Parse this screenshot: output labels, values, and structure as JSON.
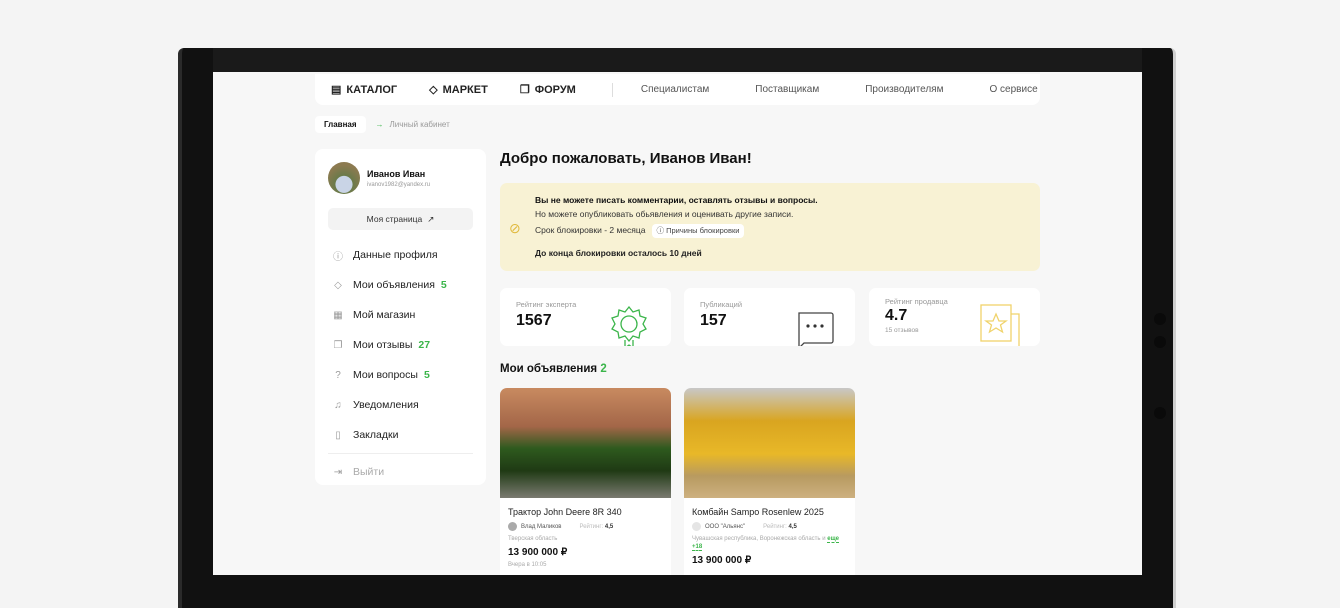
{
  "nav": {
    "main": [
      {
        "label": "КАТАЛОГ",
        "icon": "catalog-icon"
      },
      {
        "label": "МАРКЕТ",
        "icon": "market-icon"
      },
      {
        "label": "ФОРУМ",
        "icon": "forum-icon"
      }
    ],
    "secondary": [
      "Специалистам",
      "Поставщикам",
      "Производителям",
      "О сервисе"
    ]
  },
  "breadcrumb": {
    "home": "Главная",
    "current": "Личный кабинет"
  },
  "user": {
    "name": "Иванов Иван",
    "email": "ivanov1982@yandex.ru",
    "my_page": "Моя страница"
  },
  "menu": [
    {
      "label": "Данные профиля",
      "count": null
    },
    {
      "label": "Мои объявления",
      "count": "5"
    },
    {
      "label": "Мой магазин",
      "count": null
    },
    {
      "label": "Мои отзывы",
      "count": "27"
    },
    {
      "label": "Мои вопросы",
      "count": "5"
    },
    {
      "label": "Уведомления",
      "count": null
    },
    {
      "label": "Закладки",
      "count": null
    }
  ],
  "logout": "Выйти",
  "title": "Добро пожаловать, Иванов Иван!",
  "alert": {
    "line1": "Вы не можете писать комментарии, оставлять отзывы и вопросы.",
    "line2": "Но можете опубликовать обьявления и оценивать другие записи.",
    "term": "Срок блокировки - 2 месяца",
    "reasons": "Причины блокировки",
    "remaining": "До конца блокировки осталось 10 дней"
  },
  "stats": [
    {
      "label": "Рейтинг эксперта",
      "value": "1567"
    },
    {
      "label": "Публикаций",
      "value": "157"
    },
    {
      "label": "Рейтинг продавца",
      "value": "4.7",
      "sub": "15 отзывов"
    }
  ],
  "listings": {
    "title": "Мои объявления",
    "count": "2",
    "items": [
      {
        "title": "Трактор John Deere 8R 340",
        "seller": "Влад Маликов",
        "rating_label": "Рейтинг:",
        "rating": "4,5",
        "region": "Тверская область",
        "price": "13 900 000 ₽",
        "date": "Вчера в 10:05"
      },
      {
        "title": "Комбайн Sampo Rosenlew 2025",
        "seller": "ООО \"Альянс\"",
        "rating_label": "Рейтинг:",
        "rating": "4,5",
        "region": "Чувашская республика, Воронежская область и",
        "more": "еще +18",
        "price": "13 900 000 ₽"
      }
    ]
  }
}
